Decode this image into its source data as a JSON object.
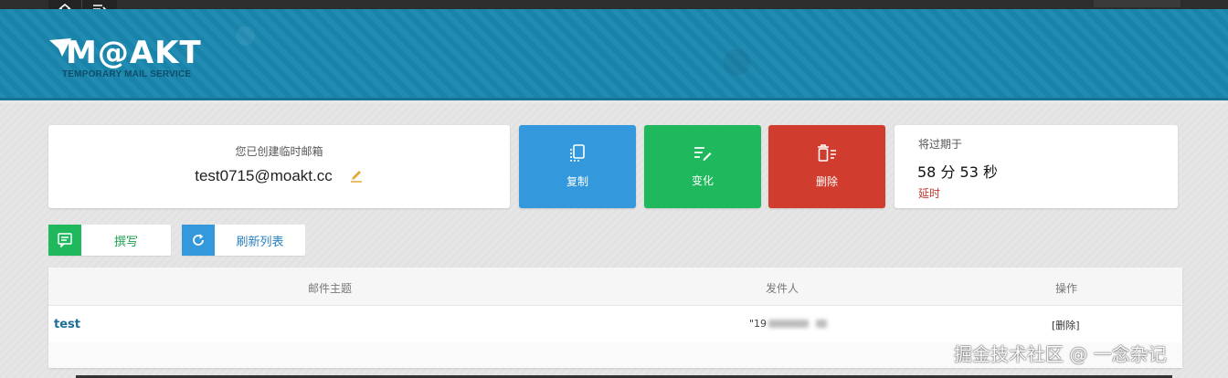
{
  "brand": {
    "logo_text": "M@AKT",
    "tagline": "TEMPORARY MAIL SERVICE"
  },
  "mailbox": {
    "label": "您已创建临时邮箱",
    "address": "test0715@moakt.cc"
  },
  "actions": {
    "copy_label": "复制",
    "change_label": "变化",
    "delete_label": "删除"
  },
  "expire": {
    "label": "将过期于",
    "time": "58 分 53 秒",
    "extend_label": "延时"
  },
  "toolbar": {
    "compose_label": "撰写",
    "refresh_label": "刷新列表"
  },
  "table": {
    "columns": [
      "邮件主题",
      "发件人",
      "操作"
    ],
    "rows": [
      {
        "subject": "test",
        "sender": "\"19",
        "action": "[删除]"
      }
    ]
  },
  "watermark": "掘金技术社区 @ 一念杂记",
  "colors": {
    "header": "#1b87b0",
    "copy": "#3399dc",
    "change": "#1fb85d",
    "delete": "#d03c2d",
    "extend": "#c0392b"
  }
}
